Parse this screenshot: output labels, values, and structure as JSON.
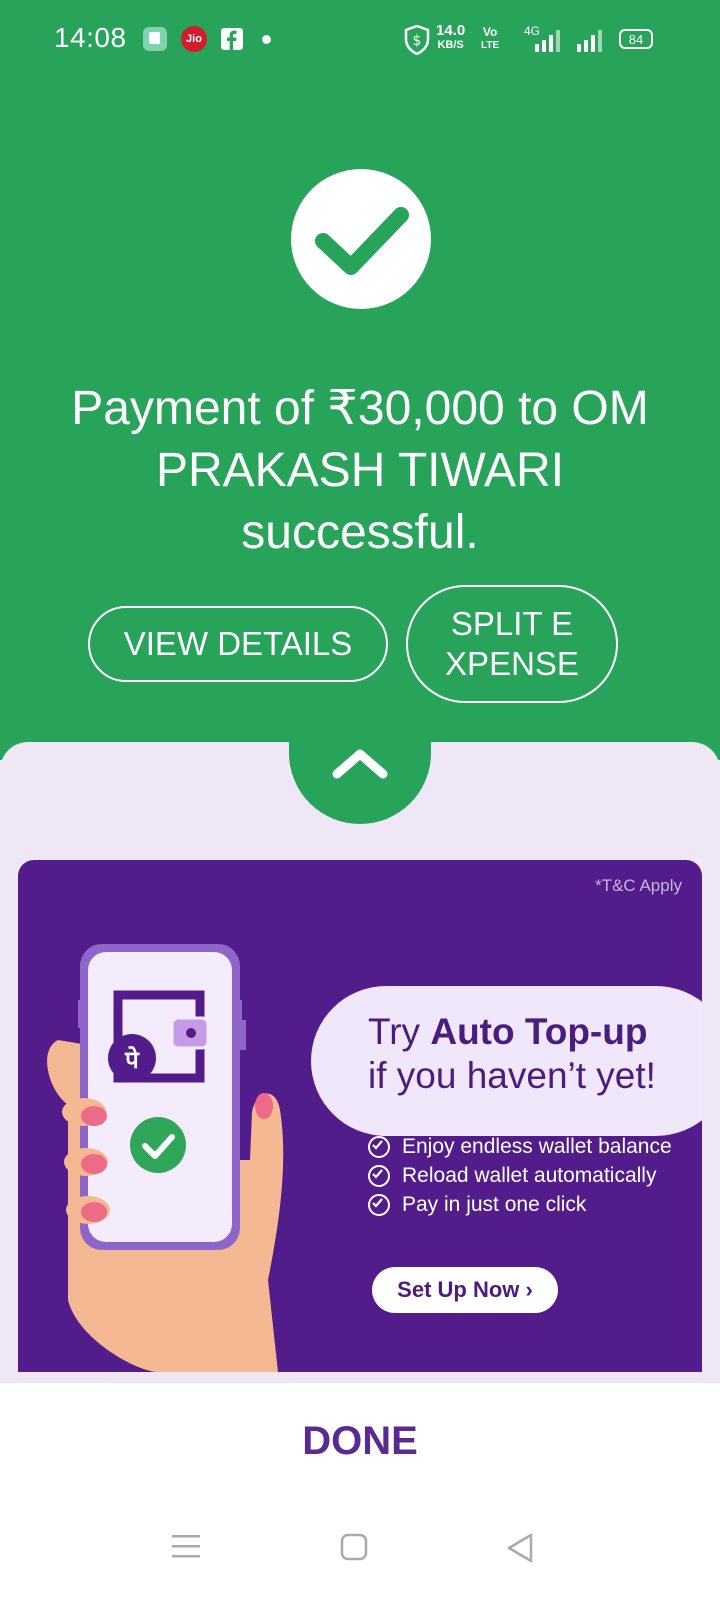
{
  "status_bar": {
    "time": "14:08",
    "jio": "Jio",
    "speed_value": "14.0",
    "speed_unit": "KB/S",
    "vo_line1": "Vo",
    "vo_line2": "LTE",
    "net": "4G",
    "battery": "84"
  },
  "success": {
    "headline": "Payment of ₹30,000 to OM PRAKASH TIWARI successful."
  },
  "actions": {
    "view_details": "VIEW DETAILS",
    "split_expense": "SPLIT E XPENSE"
  },
  "banner": {
    "tc": "*T&C Apply",
    "title_prefix": "Try",
    "title_bold": "Auto Top-up",
    "title_line2": "if you haven’t yet!",
    "features": [
      "Enjoy endless wallet balance",
      "Reload wallet automatically",
      "Pay in just one click"
    ],
    "cta": "Set Up Now ›",
    "logo_glyph": "पे"
  },
  "footer": {
    "done": "DONE"
  },
  "colors": {
    "success_green": "#27a35a",
    "brand_purple": "#521d8b",
    "sheet_bg": "#efe7f5"
  }
}
